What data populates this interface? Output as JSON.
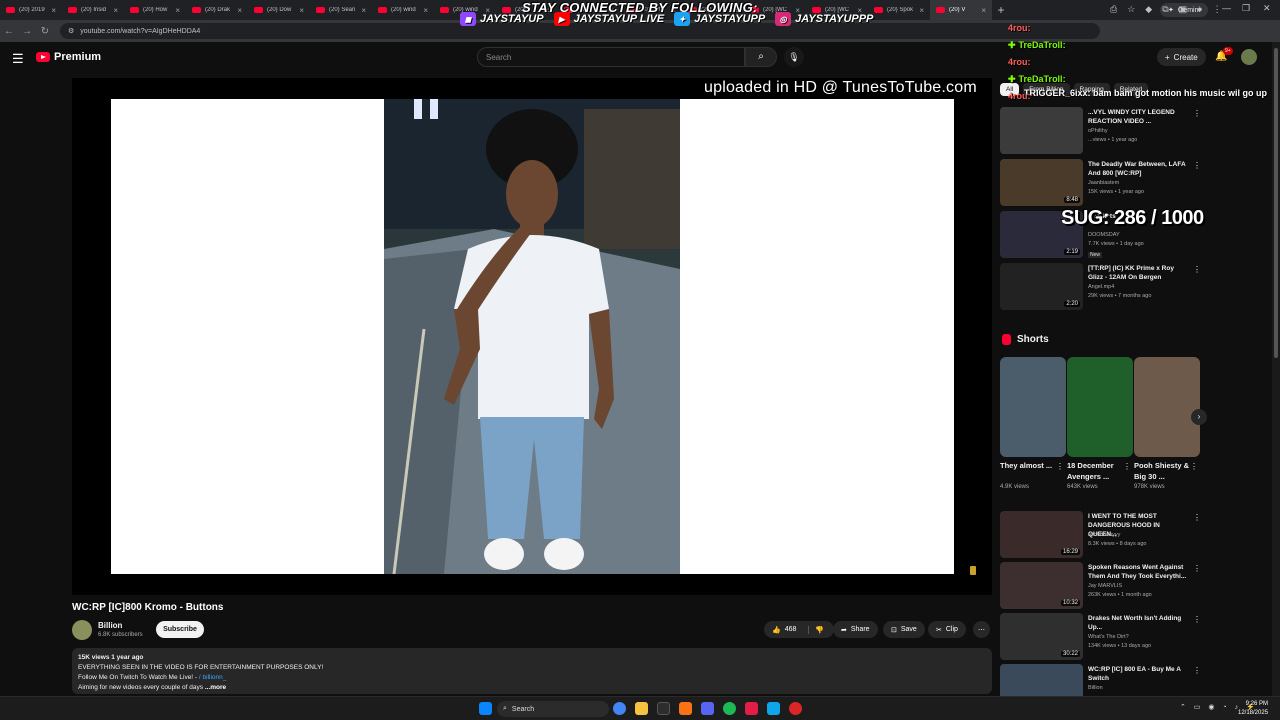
{
  "browser": {
    "tabs": [
      {
        "label": "(20) 2019"
      },
      {
        "label": "(20) Insid"
      },
      {
        "label": "(20) How"
      },
      {
        "label": "(20) Drak"
      },
      {
        "label": "(20) Dow"
      },
      {
        "label": "(20) Sean"
      },
      {
        "label": "(20) wind"
      },
      {
        "label": "(20) wind"
      },
      {
        "label": "(20)"
      },
      {
        "label": "(20)"
      },
      {
        "label": "(20) [WC"
      },
      {
        "label": "(20) [WC"
      },
      {
        "label": "(20) [WC"
      },
      {
        "label": "(20) [WC"
      },
      {
        "label": "(20) Spok"
      },
      {
        "label": "(20) V"
      }
    ],
    "new_tab": "+",
    "gemini_label": "Gemini",
    "url": "youtube.com/watch?v=AIgDHeHDDA4",
    "min": "—",
    "max": "❐",
    "close": "✕"
  },
  "overlay": {
    "banner": "STAY CONNECTED BY FOLLOWING:",
    "socials": [
      {
        "icon": "twitch-icon",
        "handle": "JAYSTAYUP",
        "color": "#9146ff"
      },
      {
        "icon": "youtube-icon",
        "handle": "JAYSTAYUP LIVE",
        "color": "#ff0000"
      },
      {
        "icon": "twitter-icon",
        "handle": "JAYSTAYUPP",
        "color": "#1da1f2"
      },
      {
        "icon": "instagram-icon",
        "handle": "JAYSTAYUPPP",
        "color": "#d62976"
      }
    ],
    "chat": [
      {
        "user": "4rou:",
        "text": "",
        "cls": "u"
      },
      {
        "user": "TreDaTroll:",
        "text": "",
        "cls": "g"
      },
      {
        "user": "4rou:",
        "text": "",
        "cls": "u"
      },
      {
        "user": "TreDaTroll:",
        "text": "",
        "cls": "g"
      },
      {
        "user": "4rou:",
        "text": "",
        "cls": "u"
      }
    ],
    "chat_top_line": "TRIGGER_6ixx: bam bam got motion his music wil go up",
    "sug": "SUG: 286 / 1000",
    "watermark": "uploaded in HD @ TunesToTube.com"
  },
  "youtube": {
    "brand": "Premium",
    "search_placeholder": "Search",
    "create_label": "Create",
    "notif_count": "9+",
    "video": {
      "title": "WC:RP [IC]800 Kromo - Buttons",
      "channel": "Billion",
      "subscribers": "6.8K subscribers",
      "subscribe_label": "Subscribe",
      "likes": "468",
      "share_label": "Share",
      "save_label": "Save",
      "clip_label": "Clip",
      "views_date": "15K views  1 year ago",
      "desc_line1": "EVERYTHING SEEN IN THE VIDEO IS FOR ENTERTAINMENT PURPOSES ONLY!",
      "desc_line2": "Follow Me On Twitch To Watch Me Live! -",
      "desc_handle": "/ billionn_",
      "desc_line3": "Aiming for new videos every couple of days",
      "more_label": "...more"
    },
    "chips": [
      "All",
      "From Billion",
      "Rapping",
      "Related"
    ],
    "recs": [
      {
        "title": "...VYL WINDY CITY LEGEND REACTION VIDEO ...",
        "channel": "oPhilthy",
        "meta": "...views • 1 year ago",
        "dur": ""
      },
      {
        "title": "The Deadly War Between, LAFA And 800 [WC:RP]",
        "channel": "Jaanbiastem",
        "meta": "15K views • 1 year ago",
        "dur": "8:48"
      },
      {
        "title": "...Tickets",
        "channel": "DOOMSDAY",
        "meta": "7.7K views • 1 day ago",
        "dur": "2:19",
        "badge": "New"
      },
      {
        "title": "[TT:RP] (IC) KK Prime x Roy Glizz - 12AM On Bergen",
        "channel": "Angel.mp4",
        "meta": "29K views • 7 months ago",
        "dur": "2:20"
      }
    ],
    "shorts_title": "Shorts",
    "shorts": [
      {
        "title": "They almost ...",
        "views": "4.9K views"
      },
      {
        "title": "18 December Avengers ...",
        "views": "643K views"
      },
      {
        "title": "Pooh Shiesty & Big 30 ...",
        "views": "978K views"
      }
    ],
    "recs2": [
      {
        "title": "I WENT TO THE MOST DANGEROUS HOOD IN QUEEN...",
        "channel": "ashhhbabyyy",
        "meta": "8.3K views • 8 days ago",
        "dur": "16:29"
      },
      {
        "title": "Spoken Reasons Went Against Them And They Took Everythi...",
        "channel": "Jay MARVLIS",
        "meta": "263K views • 1 month ago",
        "dur": "10:32"
      },
      {
        "title": "Drakes Net Worth Isn't Adding Up...",
        "channel": "What's The Dirt?",
        "meta": "134K views • 13 days ago",
        "dur": "30:22"
      },
      {
        "title": "WC:RP [IC] 800 EA - Buy Me A Switch",
        "channel": "Billion",
        "meta": "",
        "dur": ""
      }
    ]
  },
  "taskbar": {
    "search_label": "Search",
    "time": "9:26 PM",
    "date": "12/18/2025"
  }
}
